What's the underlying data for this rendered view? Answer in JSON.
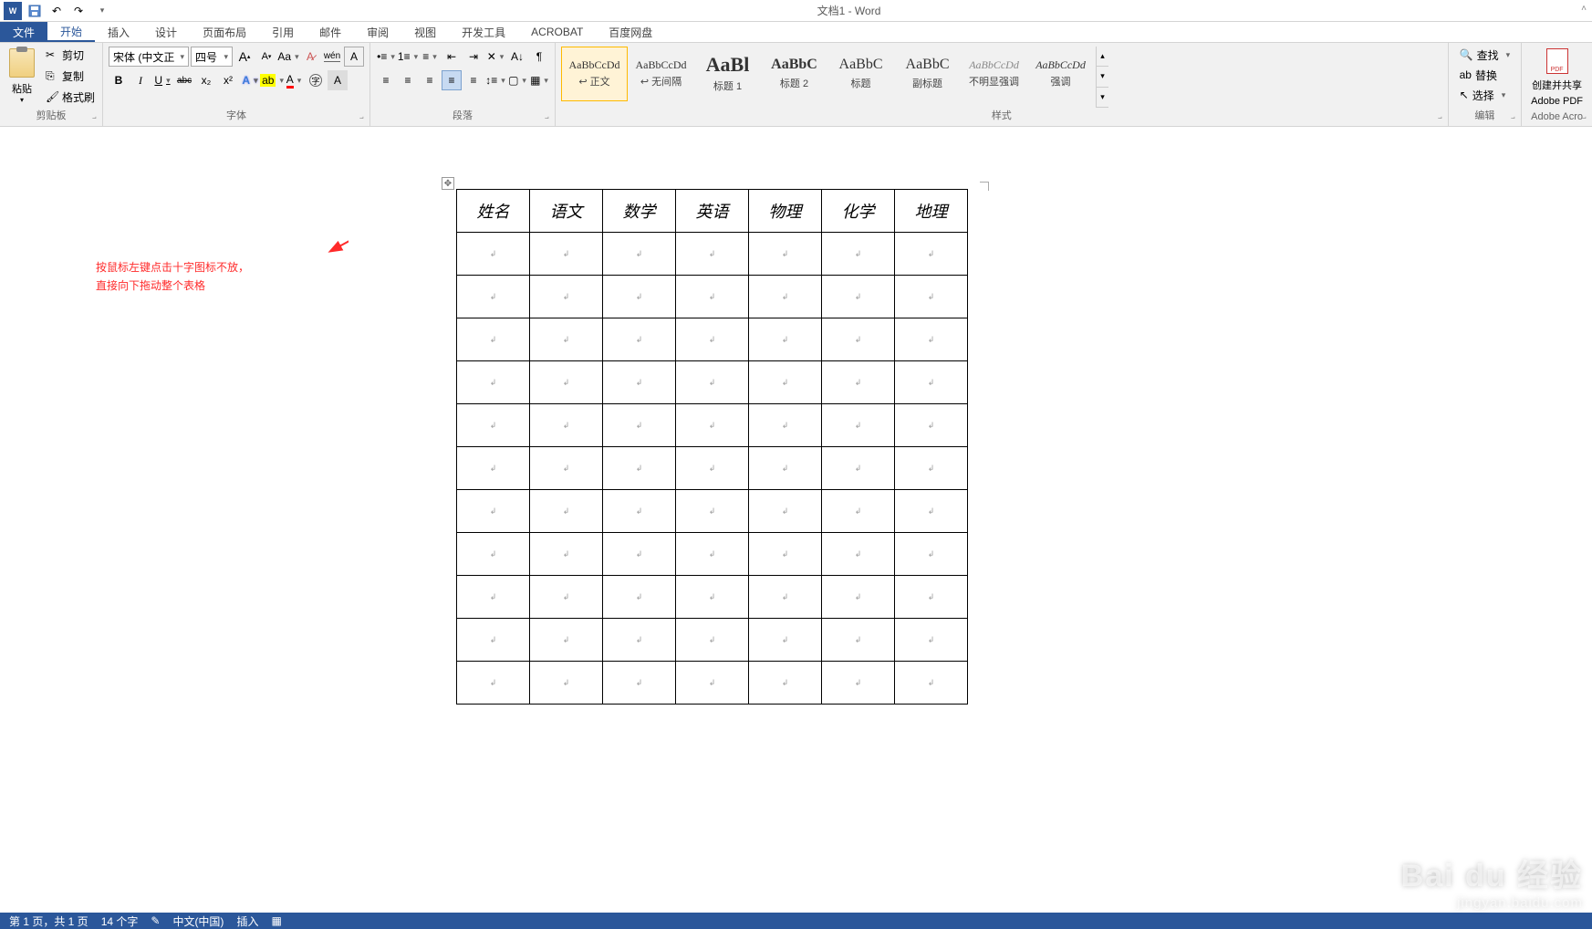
{
  "app": {
    "title": "文档1 - Word"
  },
  "tabs": {
    "file": "文件",
    "home": "开始",
    "insert": "插入",
    "design": "设计",
    "layout": "页面布局",
    "references": "引用",
    "mailings": "邮件",
    "review": "审阅",
    "view": "视图",
    "developer": "开发工具",
    "acrobat": "ACROBAT",
    "baidu": "百度网盘"
  },
  "groups": {
    "clipboard": "剪贴板",
    "font": "字体",
    "paragraph": "段落",
    "styles": "样式",
    "editing": "编辑",
    "adobe": "Adobe Acro"
  },
  "clipboard": {
    "paste": "粘贴",
    "cut": "剪切",
    "copy": "复制",
    "formatpainter": "格式刷"
  },
  "font": {
    "name": "宋体 (中文正",
    "size": "四号",
    "grow": "A",
    "shrink": "A",
    "changecase": "Aa",
    "clear": "⌫",
    "phonetic": "拼",
    "charborder": "A",
    "bold": "B",
    "italic": "I",
    "underline": "U",
    "strike": "abc",
    "sub": "x₂",
    "sup": "x²",
    "effects": "A",
    "highlight": "ab",
    "color": "A",
    "circled": "A",
    "charshading": "A"
  },
  "paragraph": {
    "bullets": "≡",
    "numbering": "≡",
    "multilevel": "≡",
    "decIndent": "≤",
    "incIndent": "≥",
    "sort": "A↓",
    "showmarks": "¶",
    "alignL": "≡",
    "alignC": "≡",
    "alignR": "≡",
    "alignJ": "≡",
    "alignD": "≡",
    "linespacing": "↕",
    "shading": "▦",
    "borders": "▦"
  },
  "styles": [
    {
      "preview": "AaBbCcDd",
      "label": "↩ 正文",
      "size": "12px",
      "selected": true
    },
    {
      "preview": "AaBbCcDd",
      "label": "↩ 无间隔",
      "size": "12px"
    },
    {
      "preview": "AaBl",
      "label": "标题 1",
      "size": "22px",
      "bold": true
    },
    {
      "preview": "AaBbC",
      "label": "标题 2",
      "size": "16px",
      "bold": true
    },
    {
      "preview": "AaBbC",
      "label": "标题",
      "size": "16px"
    },
    {
      "preview": "AaBbC",
      "label": "副标题",
      "size": "16px"
    },
    {
      "preview": "AaBbCcDd",
      "label": "不明显强调",
      "size": "12px",
      "italic": true,
      "color": "#888"
    },
    {
      "preview": "AaBbCcDd",
      "label": "强调",
      "size": "12px",
      "italic": true
    }
  ],
  "editing": {
    "find": "查找",
    "replace": "替换",
    "select": "选择"
  },
  "adobe": {
    "createshare": "创建并共享",
    "adobepdf": "Adobe PDF"
  },
  "annotation": {
    "line1": "按鼠标左键点击十字图标不放，",
    "line2": "直接向下拖动整个表格"
  },
  "table": {
    "headers": [
      "姓名",
      "语文",
      "数学",
      "英语",
      "物理",
      "化学",
      "地理"
    ],
    "empty_rows": 11,
    "cell_mark": "↲"
  },
  "statusbar": {
    "page": "第 1 页，共 1 页",
    "words": "14 个字",
    "lang": "中文(中国)",
    "mode": "插入"
  },
  "watermark": {
    "brand": "Bai du 经验",
    "url": "jingyan.baidu.com"
  }
}
